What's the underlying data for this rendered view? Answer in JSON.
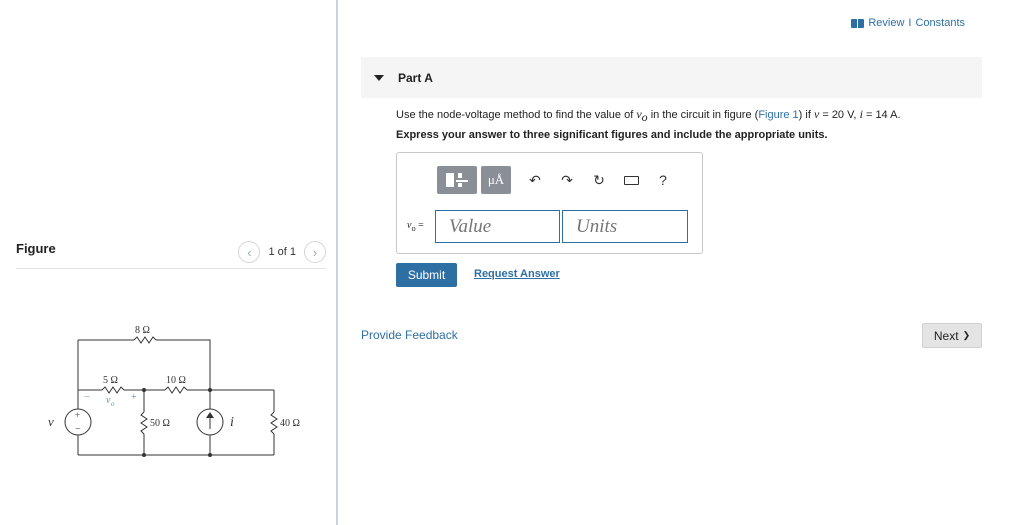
{
  "figure_panel": {
    "title": "Figure",
    "pager_text": "1 of 1",
    "circuit": {
      "labels": {
        "r8": "8 Ω",
        "r5": "5 Ω",
        "r10": "10 Ω",
        "r50": "50 Ω",
        "r40": "40 Ω",
        "vsrc": "v",
        "isrc": "i",
        "vo": "v",
        "vo_sub": "o",
        "minus": "−",
        "plus": "+"
      }
    }
  },
  "header": {
    "review_label": "Review",
    "separator": "I",
    "constants_label": "Constants"
  },
  "part": {
    "title": "Part A",
    "question_before": "Use the node-voltage method to find the value of ",
    "question_var": "v",
    "question_var_sub": "o",
    "question_mid": " in the circuit in figure (",
    "figure_link": "Figure 1",
    "question_after_link": ") if ",
    "cond_v_var": "v",
    "cond_v_value": " = 20 V, ",
    "cond_i_var": "i",
    "cond_i_value": " = 14 A.",
    "instructions": "Express your answer to three significant figures and include the appropriate units."
  },
  "answer": {
    "toolbar": {
      "units_label": "μÅ",
      "help_label": "?"
    },
    "var_label": "v",
    "var_sub": "o",
    "var_eq": " =",
    "value_placeholder": "Value",
    "units_placeholder": "Units"
  },
  "actions": {
    "submit_label": "Submit",
    "request_answer_label": "Request Answer",
    "feedback_label": "Provide Feedback",
    "next_label": "Next",
    "next_arrow": "❯"
  }
}
